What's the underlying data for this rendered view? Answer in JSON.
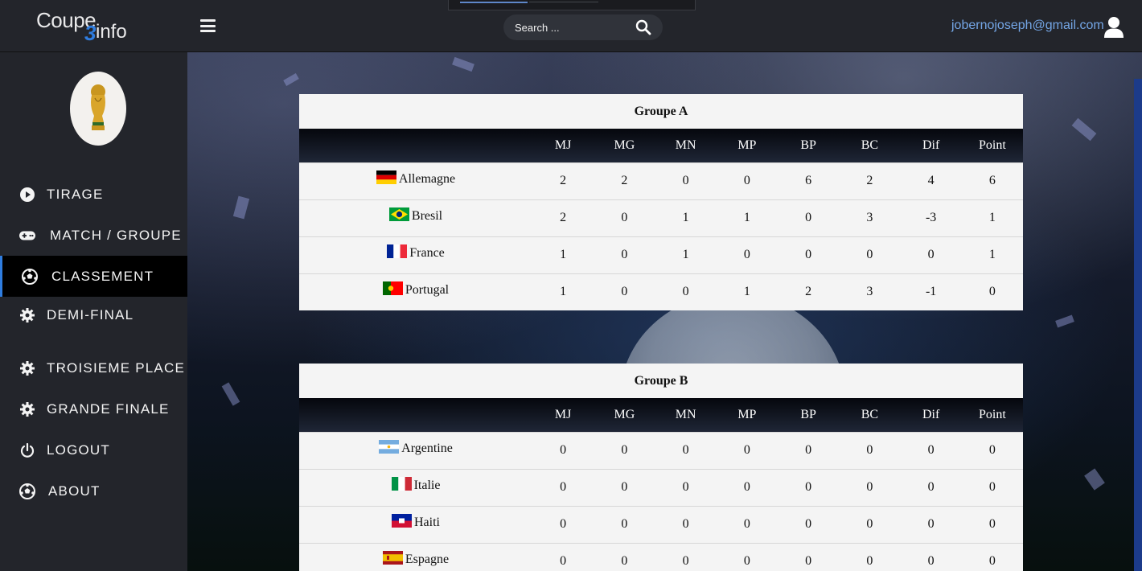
{
  "header": {
    "logo": {
      "part1": "Coupe",
      "part2": "3",
      "part3": "info"
    },
    "search_placeholder": "Search ...",
    "user_email": "jobernojoseph@gmail.com"
  },
  "sidebar": {
    "items": [
      {
        "label": "TIRAGE",
        "icon": "play-circle-icon"
      },
      {
        "label": "MATCH / GROUPE",
        "icon": "gamepad-icon"
      },
      {
        "label": "CLASSEMENT",
        "icon": "soccer-ball-icon",
        "active": true
      },
      {
        "label": "DEMI-FINAL",
        "icon": "gear-icon"
      },
      {
        "label": "TROISIEME PLACE",
        "icon": "gear-icon"
      },
      {
        "label": "GRANDE FINALE",
        "icon": "gear-icon"
      },
      {
        "label": "LOGOUT",
        "icon": "power-icon"
      },
      {
        "label": "ABOUT",
        "icon": "soccer-ball-icon"
      }
    ]
  },
  "groups": [
    {
      "title": "Groupe A",
      "headers": [
        "",
        "MJ",
        "MG",
        "MN",
        "MP",
        "BP",
        "BC",
        "Dif",
        "Point"
      ],
      "rows": [
        {
          "team": "Allemagne",
          "flag": "germany",
          "stats": [
            "2",
            "2",
            "0",
            "0",
            "6",
            "2",
            "4",
            "6"
          ]
        },
        {
          "team": "Bresil",
          "flag": "brazil",
          "stats": [
            "2",
            "0",
            "1",
            "1",
            "0",
            "3",
            "-3",
            "1"
          ]
        },
        {
          "team": "France",
          "flag": "france",
          "stats": [
            "1",
            "0",
            "1",
            "0",
            "0",
            "0",
            "0",
            "1"
          ]
        },
        {
          "team": "Portugal",
          "flag": "portugal",
          "stats": [
            "1",
            "0",
            "0",
            "1",
            "2",
            "3",
            "-1",
            "0"
          ]
        }
      ]
    },
    {
      "title": "Groupe B",
      "headers": [
        "",
        "MJ",
        "MG",
        "MN",
        "MP",
        "BP",
        "BC",
        "Dif",
        "Point"
      ],
      "rows": [
        {
          "team": "Argentine",
          "flag": "argentina",
          "stats": [
            "0",
            "0",
            "0",
            "0",
            "0",
            "0",
            "0",
            "0"
          ]
        },
        {
          "team": "Italie",
          "flag": "italy",
          "stats": [
            "0",
            "0",
            "0",
            "0",
            "0",
            "0",
            "0",
            "0"
          ]
        },
        {
          "team": "Haiti",
          "flag": "haiti",
          "stats": [
            "0",
            "0",
            "0",
            "0",
            "0",
            "0",
            "0",
            "0"
          ]
        },
        {
          "team": "Espagne",
          "flag": "spain",
          "stats": [
            "0",
            "0",
            "0",
            "0",
            "0",
            "0",
            "0",
            "0"
          ]
        }
      ]
    }
  ],
  "colors": {
    "accent": "#2f7de0",
    "sidebar_bg": "#23252b",
    "email_link": "#74a6e6"
  }
}
